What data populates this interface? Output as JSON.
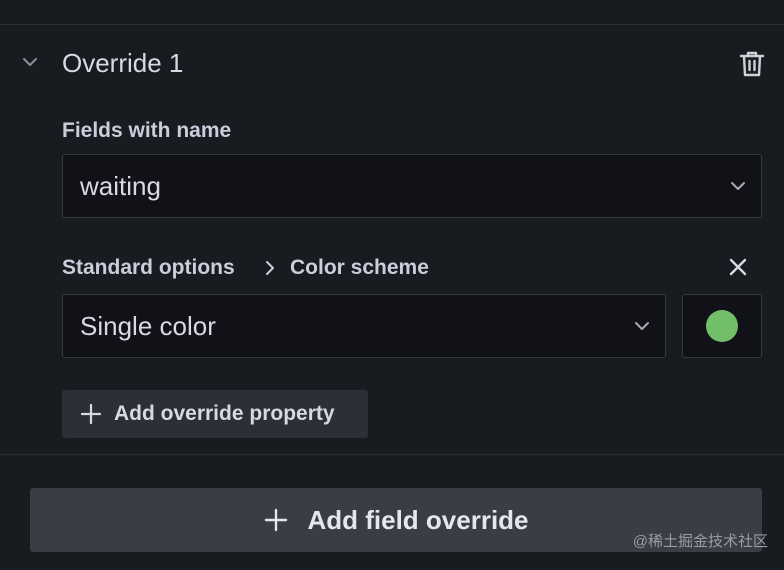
{
  "override": {
    "title": "Override 1",
    "fields_label": "Fields with name",
    "field_value": "waiting",
    "property": {
      "category": "Standard options",
      "name": "Color scheme",
      "value": "Single color",
      "color": "#73bf69"
    },
    "add_property_label": "Add override property"
  },
  "add_field_override_label": "Add field override",
  "watermark": "@稀土掘金技术社区",
  "icons": {
    "collapse": "chevron-down-icon",
    "delete": "trash-icon",
    "dropdown": "chevron-down-icon",
    "separator": "chevron-right-icon",
    "remove": "close-icon",
    "add": "plus-icon"
  }
}
